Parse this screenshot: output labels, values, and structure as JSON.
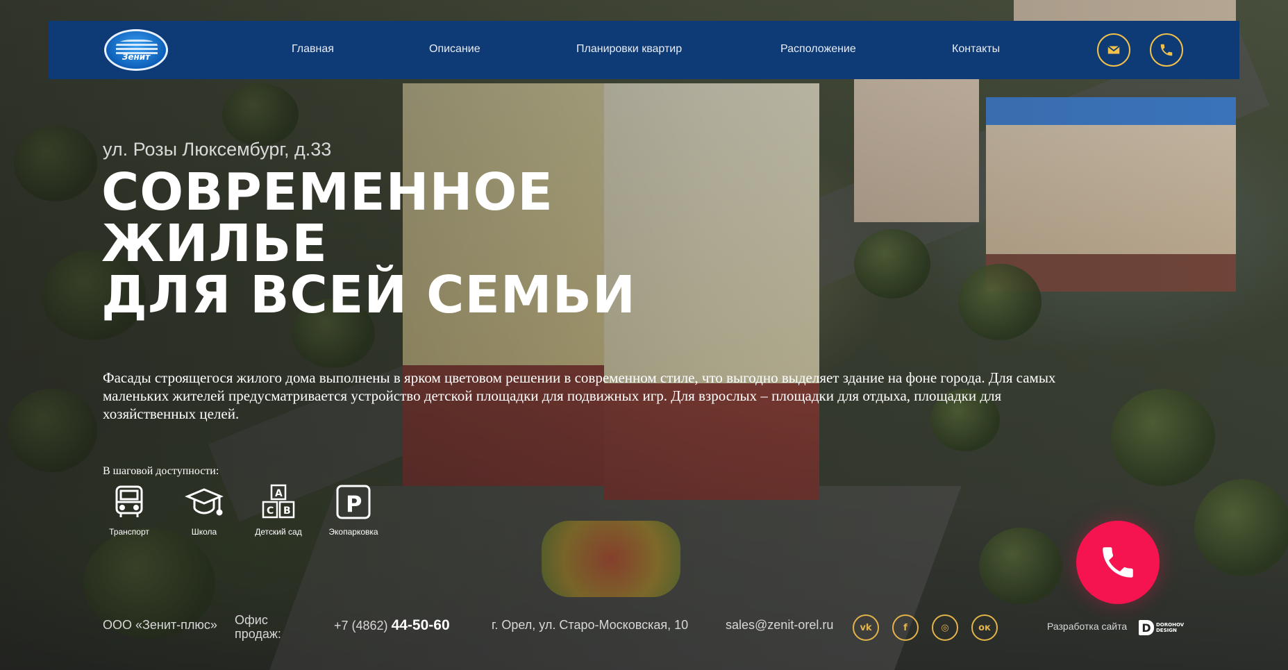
{
  "header": {
    "logo_text": "Зенит",
    "nav": [
      {
        "label": "Главная"
      },
      {
        "label": "Описание"
      },
      {
        "label": "Планировки квартир"
      },
      {
        "label": "Расположение"
      },
      {
        "label": "Контакты"
      }
    ],
    "icons": {
      "mail": "mail-icon",
      "phone": "phone-icon"
    }
  },
  "hero": {
    "address": "ул. Розы Люксембург, д.33",
    "headline": [
      "СОВРЕМЕННОЕ",
      "ЖИЛЬЕ",
      "ДЛЯ ВСЕЙ СЕМЬИ"
    ],
    "description": "Фасады строящегося жилого дома выполнены в ярком цветовом решении в современном стиле, что выгодно выделяет здание на фоне города. Для самых маленьких жителей предусматривается устройство детской площадки для подвижных игр. Для взрослых – площадки для отдыха, площадки для хозяйственных целей.",
    "access_title": "В шаговой доступности:",
    "features": [
      {
        "label": "Транспорт",
        "icon": "bus-icon"
      },
      {
        "label": "Школа",
        "icon": "graduation-cap-icon"
      },
      {
        "label": "Детский сад",
        "icon": "abc-blocks-icon"
      },
      {
        "label": "Экопарковка",
        "icon": "parking-icon"
      }
    ]
  },
  "footer": {
    "company": "ООО «Зенит-плюс»",
    "office_label": "Офис продаж:",
    "phone_prefix": "+7 (4862)",
    "phone_number": "44-50-60",
    "address": "г. Орел, ул. Старо-Московская, 10",
    "email": "sales@zenit-orel.ru",
    "social": [
      {
        "name": "vk-icon",
        "glyph": "vk"
      },
      {
        "name": "facebook-icon",
        "glyph": "f"
      },
      {
        "name": "instagram-icon",
        "glyph": "◎"
      },
      {
        "name": "odnoklassniki-icon",
        "glyph": "ок"
      }
    ],
    "developer_label": "Разработка сайта",
    "developer_logo_letter": "D",
    "developer_logo_text": [
      "DOROHOV",
      "DESIGN"
    ]
  },
  "colors": {
    "header_bg": "#0e3a75",
    "accent_gold": "#f2c14a",
    "call_button": "#f5144f"
  }
}
